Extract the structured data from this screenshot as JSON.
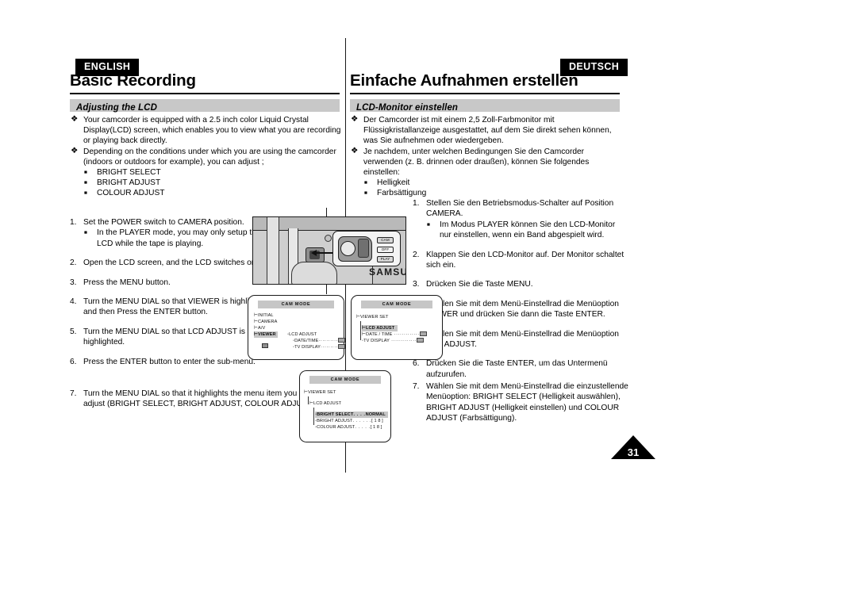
{
  "page": {
    "number": "31"
  },
  "left": {
    "lang_tag": "ENGLISH",
    "chapter_title": "Basic Recording",
    "section_title": "Adjusting the LCD",
    "intro": [
      {
        "marker": "diamond",
        "text": "Your camcorder is equipped with a 2.5 inch color Liquid Crystal Display(LCD) screen, which enables you to view what you are recording or playing back directly."
      },
      {
        "marker": "diamond",
        "text": "Depending on the conditions under which you are using the camcorder (indoors or outdoors for example), you can adjust ;"
      }
    ],
    "adjust_items": [
      "BRIGHT SELECT",
      "BRIGHT ADJUST",
      "COLOUR ADJUST"
    ],
    "steps": [
      {
        "num": "1.",
        "text": "Set the POWER switch to CAMERA position.",
        "sub": "In the PLAYER mode, you may only setup the LCD while the tape is playing."
      },
      {
        "num": "2.",
        "text": "Open the LCD screen, and the LCD switches on.",
        "sub": ""
      },
      {
        "num": "3.",
        "text": "Press the MENU button.",
        "sub": ""
      },
      {
        "num": "4.",
        "text": "Turn the MENU DIAL so that VIEWER is highlighted and then Press the ENTER button.",
        "sub": ""
      },
      {
        "num": "5.",
        "text": "Turn the MENU DIAL so that LCD ADJUST is highlighted.",
        "sub": ""
      },
      {
        "num": "6.",
        "text": "Press the ENTER button to enter the sub-menu.",
        "sub": ""
      }
    ],
    "step7": {
      "num": "7.",
      "text": "Turn the MENU DIAL so that it highlights the menu item you want to adjust (BRIGHT SELECT, BRIGHT ADJUST, COLOUR ADJUST)."
    }
  },
  "right": {
    "lang_tag": "DEUTSCH",
    "chapter_title": "Einfache Aufnahmen erstellen",
    "section_title": "LCD-Monitor einstellen",
    "intro": [
      {
        "marker": "diamond",
        "text": "Der Camcorder ist mit einem 2,5 Zoll-Farbmonitor mit Flüssigkristallanzeige ausgestattet, auf dem Sie direkt sehen können, was Sie aufnehmen oder wiedergeben."
      },
      {
        "marker": "diamond",
        "text": "Je nachdem, unter welchen Bedingungen Sie den Camcorder verwenden (z. B. drinnen oder draußen), können Sie folgendes einstellen:"
      }
    ],
    "adjust_items": [
      "Helligkeit",
      "Farbsättigung"
    ],
    "steps": [
      {
        "num": "1.",
        "text": "Stellen Sie den Betriebsmodus-Schalter auf Position CAMERA.",
        "sub": "Im Modus PLAYER können Sie den LCD-Monitor nur einstellen, wenn ein Band abgespielt wird."
      },
      {
        "num": "2.",
        "text": "Klappen Sie den LCD-Monitor auf. Der Monitor schaltet sich ein.",
        "sub": ""
      },
      {
        "num": "3.",
        "text": "Drücken Sie die Taste MENU.",
        "sub": ""
      },
      {
        "num": "4.",
        "text": "Wählen Sie mit dem Menü-Einstellrad die Menüoption VIEWER und drücken Sie dann die Taste ENTER.",
        "sub": ""
      },
      {
        "num": "5.",
        "text": "Wählen Sie mit dem Menü-Einstellrad die Menüoption LCD ADJUST.",
        "sub": ""
      },
      {
        "num": "6.",
        "text": "Drücken Sie die Taste ENTER, um das Untermenü aufzurufen.",
        "sub": ""
      }
    ],
    "step7": {
      "num": "7.",
      "text": "Wählen Sie mit dem Menü-Einstellrad die einzustellende Menüoption: BRIGHT SELECT (Helligkeit auswählen), BRIGHT ADJUST (Helligkeit einstellen) und COLOUR ADJUST (Farbsättigung)."
    }
  },
  "illustration": {
    "brand": "SAMSUNG",
    "switch_labels": [
      "CAM",
      "OFF",
      "PLAY"
    ]
  },
  "osd_screens": [
    {
      "id": "osd-main-menu",
      "title": "CAM MODE",
      "left_items": [
        {
          "label": "INITIAL",
          "highlighted": false
        },
        {
          "label": "CAMERA",
          "highlighted": false
        },
        {
          "label": "A/V",
          "highlighted": false
        },
        {
          "label": "VIEWER",
          "highlighted": true
        }
      ],
      "right_items": [
        {
          "label": "LCD ADJUST",
          "value": ""
        },
        {
          "label": "DATE/TIME",
          "value": "chip"
        },
        {
          "label": "TV DISPLAY",
          "value": "chip"
        }
      ]
    },
    {
      "id": "osd-viewer-set",
      "title": "CAM MODE",
      "header": "VIEWER SET",
      "items": [
        {
          "label": "LCD ADJUST",
          "value": "",
          "highlighted": true
        },
        {
          "label": "DATE / TIME",
          "value": "chip",
          "highlighted": false
        },
        {
          "label": "TV DISPLAY",
          "value": "chip",
          "highlighted": false
        }
      ]
    },
    {
      "id": "osd-lcd-adjust",
      "title": "CAM MODE",
      "header": "VIEWER SET",
      "subheader": "LCD ADJUST",
      "items": [
        {
          "label": "BRIGHT SELECT",
          "dots": ". . . .",
          "value": "NORMAL",
          "highlighted": true
        },
        {
          "label": "BRIGHT ADJUST",
          "dots": ". . . . . .",
          "value": "[ 1 8 ]",
          "highlighted": false
        },
        {
          "label": "COLOUR ADJUST",
          "dots": ". . . . .",
          "value": "[ 1 8 ]",
          "highlighted": false
        }
      ]
    }
  ]
}
